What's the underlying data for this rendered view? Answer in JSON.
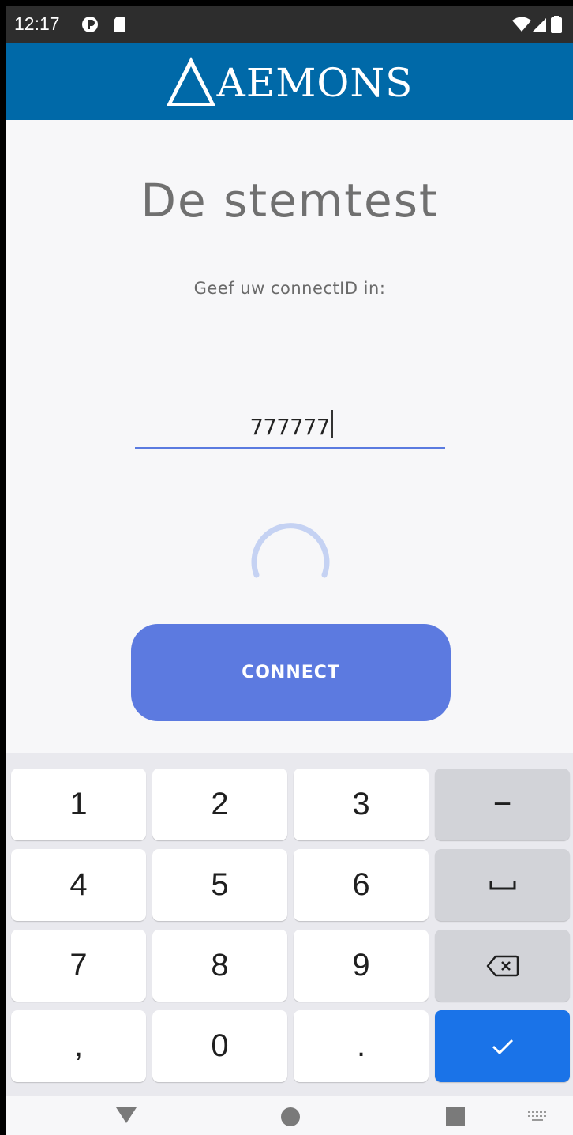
{
  "status_bar": {
    "time": "12:17",
    "icons": [
      "circle-p-icon",
      "sd-card-icon",
      "wifi-icon",
      "signal-icon",
      "battery-icon"
    ]
  },
  "app_bar": {
    "logo_text": "AEMONS",
    "logo_icon": "delta-triangle-icon",
    "background": "#0069a8"
  },
  "main": {
    "title": "De stemtest",
    "prompt": "Geef uw connectID in:",
    "connect_id_value": "777777",
    "connect_button_label": "CONNECT",
    "accent": "#5c7ae0"
  },
  "keyboard": {
    "rows": [
      [
        "1",
        "2",
        "3",
        "−"
      ],
      [
        "4",
        "5",
        "6",
        "␣"
      ],
      [
        "7",
        "8",
        "9",
        "⌫"
      ],
      [
        ",",
        "0",
        ".",
        "✓"
      ]
    ],
    "enter_color": "#1a73e8"
  },
  "nav_bar": {
    "icons": [
      "back-triangle-icon",
      "home-circle-icon",
      "recents-square-icon",
      "keyboard-switch-icon"
    ]
  }
}
